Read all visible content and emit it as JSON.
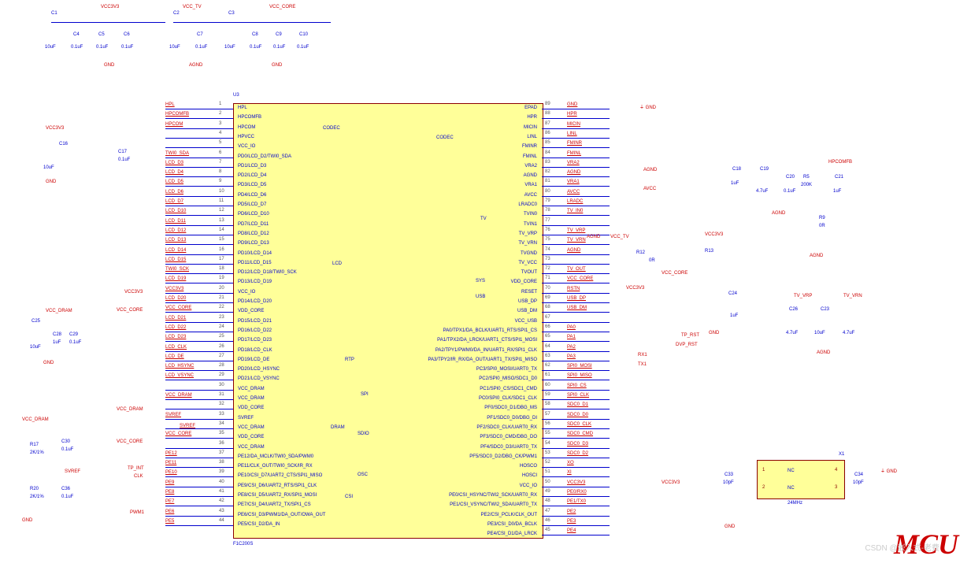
{
  "ic": {
    "ref": "U3",
    "part": "F1C200S"
  },
  "left_pins": [
    {
      "n": "1",
      "name": "HPL",
      "net": "HPL"
    },
    {
      "n": "2",
      "name": "HPCOMFB",
      "net": "HPCOMFB"
    },
    {
      "n": "3",
      "name": "HPCOM",
      "net": "HPCOM"
    },
    {
      "n": "4",
      "name": "HPVCC",
      "net": ""
    },
    {
      "n": "5",
      "name": "VCC_IO",
      "net": ""
    },
    {
      "n": "6",
      "name": "PD0/LCD_D2/TWI0_SDA",
      "net": "TWI0_SDA"
    },
    {
      "n": "7",
      "name": "PD1/LCD_D3",
      "net": "LCD_D3"
    },
    {
      "n": "8",
      "name": "PD2/LCD_D4",
      "net": "LCD_D4"
    },
    {
      "n": "9",
      "name": "PD3/LCD_D5",
      "net": "LCD_D5"
    },
    {
      "n": "10",
      "name": "PD4/LCD_D6",
      "net": "LCD_D6"
    },
    {
      "n": "11",
      "name": "PD5/LCD_D7",
      "net": "LCD_D7"
    },
    {
      "n": "12",
      "name": "PD6/LCD_D10",
      "net": "LCD_D10"
    },
    {
      "n": "13",
      "name": "PD7/LCD_D11",
      "net": "LCD_D11"
    },
    {
      "n": "14",
      "name": "PD8/LCD_D12",
      "net": "LCD_D12"
    },
    {
      "n": "15",
      "name": "PD9/LCD_D13",
      "net": "LCD_D13"
    },
    {
      "n": "16",
      "name": "PD10/LCD_D14",
      "net": "LCD_D14"
    },
    {
      "n": "17",
      "name": "PD11/LCD_D15",
      "net": "LCD_D15"
    },
    {
      "n": "18",
      "name": "PD12/LCD_D18/TWI0_SCK",
      "net": "TWI0_SCK"
    },
    {
      "n": "19",
      "name": "PD13/LCD_D19",
      "net": "LCD_D19"
    },
    {
      "n": "20",
      "name": "VCC_IO",
      "net": "VCC3V3"
    },
    {
      "n": "21",
      "name": "PD14/LCD_D20",
      "net": "LCD_D20"
    },
    {
      "n": "22",
      "name": "VDD_CORE",
      "net": "VCC_CORE"
    },
    {
      "n": "23",
      "name": "PD15/LCD_D21",
      "net": "LCD_D21"
    },
    {
      "n": "24",
      "name": "PD16/LCD_D22",
      "net": "LCD_D22"
    },
    {
      "n": "25",
      "name": "PD17/LCD_D23",
      "net": "LCD_D23"
    },
    {
      "n": "26",
      "name": "PD18/LCD_CLK",
      "net": "LCD_CLK"
    },
    {
      "n": "27",
      "name": "PD19/LCD_DE",
      "net": "LCD_DE"
    },
    {
      "n": "28",
      "name": "PD20/LCD_HSYNC",
      "net": "LCD_HSYNC"
    },
    {
      "n": "29",
      "name": "PD21/LCD_VSYNC",
      "net": "LCD_VSYNC"
    },
    {
      "n": "30",
      "name": "VCC_DRAM",
      "net": ""
    },
    {
      "n": "31",
      "name": "VCC_DRAM",
      "net": "VCC_DRAM"
    },
    {
      "n": "32",
      "name": "VDD_CORE",
      "net": ""
    },
    {
      "n": "33",
      "name": "SVREF",
      "net": "SVREF"
    },
    {
      "n": "34",
      "name": "VCC_DRAM",
      "net": ""
    },
    {
      "n": "35",
      "name": "VDD_CORE",
      "net": "VCC_CORE"
    },
    {
      "n": "36",
      "name": "VCC_DRAM",
      "net": ""
    },
    {
      "n": "37",
      "name": "PE12/DA_MCLK/TWI0_SDA/PWM0",
      "net": "PE12"
    },
    {
      "n": "38",
      "name": "PE11/CLK_OUT/TWI0_SCK/IR_RX",
      "net": "PE11"
    },
    {
      "n": "39",
      "name": "PE10/CSI_D7/UART2_CTS/SPI1_MISO",
      "net": "PE10"
    },
    {
      "n": "40",
      "name": "PE9/CSI_D6/UART2_RTS/SPI1_CLK",
      "net": "PE9"
    },
    {
      "n": "41",
      "name": "PE8/CSI_D5/UART2_RX/SPI1_MOSI",
      "net": "PE8"
    },
    {
      "n": "42",
      "name": "PE7/CSI_D4/UART2_TX/SPI1_CS",
      "net": "PE7"
    },
    {
      "n": "43",
      "name": "PE6/CSI_D3/PWM1/DA_OUT/OWA_OUT",
      "net": "PE6"
    },
    {
      "n": "44",
      "name": "PE5/CSI_D2/DA_IN",
      "net": "PE5"
    }
  ],
  "right_pins": [
    {
      "n": "89",
      "name": "EPAD",
      "net": "GND"
    },
    {
      "n": "88",
      "name": "HPR",
      "net": "HPR"
    },
    {
      "n": "87",
      "name": "MICIN",
      "net": "MICIN"
    },
    {
      "n": "86",
      "name": "LINL",
      "net": "LINL"
    },
    {
      "n": "85",
      "name": "FMINR",
      "net": "FMINR"
    },
    {
      "n": "84",
      "name": "FMINL",
      "net": "FMINL"
    },
    {
      "n": "83",
      "name": "VRA2",
      "net": "VRA2"
    },
    {
      "n": "82",
      "name": "AGND",
      "net": "AGND"
    },
    {
      "n": "81",
      "name": "VRA1",
      "net": "VRA1"
    },
    {
      "n": "80",
      "name": "AVCC",
      "net": "AVCC"
    },
    {
      "n": "79",
      "name": "LRADC0",
      "net": "LRADC"
    },
    {
      "n": "78",
      "name": "TVIN0",
      "net": "TV_IN0"
    },
    {
      "n": "77",
      "name": "TVIN1",
      "net": ""
    },
    {
      "n": "76",
      "name": "TV_VRP",
      "net": "TV_VRP"
    },
    {
      "n": "75",
      "name": "TV_VRN",
      "net": "TV_VRN"
    },
    {
      "n": "74",
      "name": "TVGND",
      "net": "AGND"
    },
    {
      "n": "73",
      "name": "TV_VCC",
      "net": ""
    },
    {
      "n": "72",
      "name": "TVOUT",
      "net": "TV_OUT"
    },
    {
      "n": "71",
      "name": "VDD_CORE",
      "net": "VCC_CORE"
    },
    {
      "n": "70",
      "name": "RESET",
      "net": "RSTN"
    },
    {
      "n": "69",
      "name": "USB_DP",
      "net": "USB_DP"
    },
    {
      "n": "68",
      "name": "USB_DM",
      "net": "USB_DM"
    },
    {
      "n": "67",
      "name": "VCC_USB",
      "net": ""
    },
    {
      "n": "66",
      "name": "PA0/TPX1/DA_BCLK/UART1_RTS/SPI1_CS",
      "net": "PA0"
    },
    {
      "n": "65",
      "name": "PA1/TPX2/DA_LRCK/UART1_CTS/SPI1_MOSI",
      "net": "PA1"
    },
    {
      "n": "64",
      "name": "PA2/TPY1/PWM0/DA_IN/UART1_RX/SPI1_CLK",
      "net": "PA2"
    },
    {
      "n": "63",
      "name": "PA3/TPY2/IR_RX/DA_OUT/UART1_TX/SPI1_MISO",
      "net": "PA3"
    },
    {
      "n": "62",
      "name": "PC3/SPI0_MOSI/UART0_TX",
      "net": "SPI0_MOSI"
    },
    {
      "n": "61",
      "name": "PC2/SPI0_MISO/SDC1_D0",
      "net": "SPI0_MISO"
    },
    {
      "n": "60",
      "name": "PC1/SPI0_CS/SDC1_CMD",
      "net": "SPI0_CS"
    },
    {
      "n": "59",
      "name": "PC0/SPI0_CLK/SDC1_CLK",
      "net": "SPI0_CLK"
    },
    {
      "n": "58",
      "name": "PF0/SDC0_D1/DBG_MS",
      "net": "SDC0_D1"
    },
    {
      "n": "57",
      "name": "PF1/SDC0_D0/DBG_DI",
      "net": "SDC0_D0"
    },
    {
      "n": "56",
      "name": "PF2/SDC0_CLK/UART0_RX",
      "net": "SDC0_CLK"
    },
    {
      "n": "55",
      "name": "PF3/SDC0_CMD/DBG_DO",
      "net": "SDC0_CMD"
    },
    {
      "n": "54",
      "name": "PF4/SDC0_D3/UART0_TX",
      "net": "SDC0_D3"
    },
    {
      "n": "53",
      "name": "PF5/SDC0_D2/DBG_CK/PWM1",
      "net": "SDC0_D2"
    },
    {
      "n": "52",
      "name": "HOSCO",
      "net": "XO"
    },
    {
      "n": "51",
      "name": "HOSCI",
      "net": "XI"
    },
    {
      "n": "50",
      "name": "VCC_IO",
      "net": "VCC3V3"
    },
    {
      "n": "49",
      "name": "PE0/CSI_HSYNC/TWI2_SCK/UART0_RX",
      "net": "PE0/RX0"
    },
    {
      "n": "48",
      "name": "PE1/CSI_VSYNC/TWI2_SDA/UART0_TX",
      "net": "PE1/TX0"
    },
    {
      "n": "47",
      "name": "PE2/CSI_PCLK/CLK_OUT",
      "net": "PE2"
    },
    {
      "n": "46",
      "name": "PE3/CSI_D0/DA_BCLK",
      "net": "PE3"
    },
    {
      "n": "45",
      "name": "PE4/CSI_D1/DA_LRCK",
      "net": "PE4"
    }
  ],
  "buses": {
    "codec": "CODEC",
    "lcd": "LCD",
    "dram": "DRAM",
    "rtp": "RTP",
    "spi": "SPI",
    "sdio": "SDIO",
    "osc": "OSC",
    "tv": "TV",
    "sys": "SYS",
    "usb": "USB",
    "csi": "CSI"
  },
  "decoupling": {
    "top": [
      {
        "rail": "VCC3V3",
        "parts": [
          "C1",
          "C4",
          "C5",
          "C6"
        ],
        "values": [
          "10uF",
          "0.1uF",
          "0.1uF",
          "0.1uF"
        ],
        "gnd": "GND"
      },
      {
        "rail": "VCC_TV",
        "parts": [
          "C2",
          "C7",
          "C8"
        ],
        "values": [
          "10uF",
          "0.1uF",
          "0.1uF"
        ],
        "gnd": "AGND"
      },
      {
        "rail": "VCC_CORE",
        "parts": [
          "C3",
          "C8",
          "C9",
          "C10"
        ],
        "values": [
          "10uF",
          "0.1uF",
          "0.1uF",
          "0.1uF"
        ],
        "gnd": "GND"
      }
    ],
    "left1": {
      "rail": "VCC3V3",
      "parts": [
        "C16",
        "C17"
      ],
      "values": [
        "10uF",
        "0.1uF"
      ],
      "gnd": "GND"
    },
    "dram": {
      "rail": "VCC_DRAM",
      "parts": [
        "C25",
        "C28",
        "C29"
      ],
      "values": [
        "10uF",
        "1uF",
        "0.1uF"
      ],
      "gnd": "GND"
    },
    "svref": {
      "top_r": "R17",
      "top_v": "2K/1%",
      "bot_r": "R20",
      "bot_v": "2K/1%",
      "caps": [
        "C30",
        "C36"
      ],
      "cap_v": "0.1uF",
      "rail": "VCC_DRAM",
      "out": "SVREF",
      "gnd": "GND"
    }
  },
  "right_side": {
    "avcc_block": {
      "parts": [
        "C18",
        "C19",
        "C20",
        "R5",
        "C21"
      ],
      "values": [
        "1uF",
        "4.7uF",
        "0.1uF",
        "200K",
        "1uF"
      ],
      "net": "HPCOMFB",
      "gnd": "AGND",
      "r9": {
        "ref": "R9",
        "val": "0R"
      }
    },
    "vcc_tv": "VCC_TV",
    "vcc3v3": "VCC3V3",
    "r12": {
      "ref": "R12",
      "val": "0R"
    },
    "r13": {
      "ref": "R13"
    },
    "c24": {
      "ref": "C24",
      "val": "1uF"
    },
    "gnd": "GND",
    "tv_caps": {
      "parts": [
        "C26",
        "C23"
      ],
      "vals": [
        "4.7uF",
        "10uF",
        "4.7uF"
      ],
      "nets": [
        "TV_VRP",
        "TV_VRN"
      ],
      "gnd": "AGND"
    },
    "ext": [
      "TP_RST",
      "DVP_RST",
      "RX1",
      "TX1"
    ]
  },
  "osc": {
    "ref": "X1",
    "val": "24MHz",
    "pins": [
      "1",
      "2",
      "3",
      "4"
    ],
    "nc": "NC",
    "caps": [
      "C33",
      "C34"
    ],
    "cap_v": "10pF",
    "gnd": "GND"
  },
  "labels": {
    "tp_int": "TP_INT",
    "clk": "CLK",
    "pwm1": "PWM1"
  },
  "mcu": "MCU",
  "watermark": "CSDN @嵌入式-老费"
}
